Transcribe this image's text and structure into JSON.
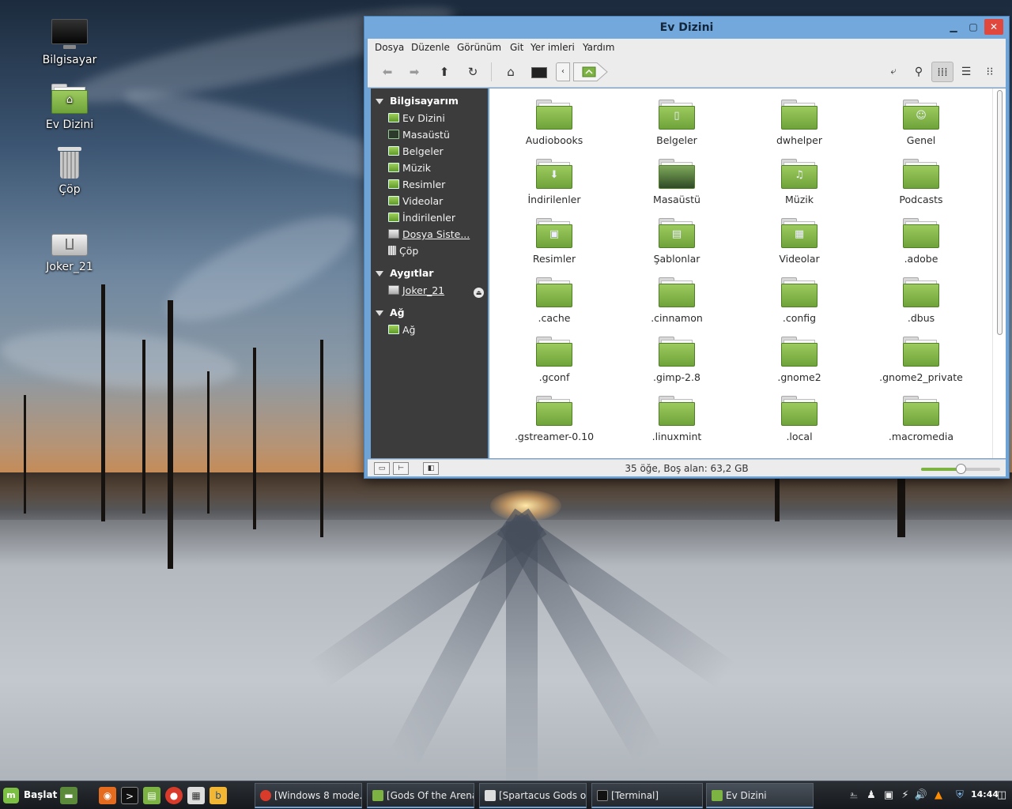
{
  "desktop": {
    "icons": [
      {
        "label": "Bilgisayar",
        "icon": "computer-icon"
      },
      {
        "label": "Ev Dizini",
        "icon": "home-folder-icon"
      },
      {
        "label": "Çöp",
        "icon": "trash-icon"
      },
      {
        "label": "Joker_21",
        "icon": "usb-drive-icon"
      }
    ]
  },
  "window": {
    "title": "Ev Dizini",
    "controls": {
      "minimize": "▁",
      "maximize": "▢",
      "close": "✕"
    },
    "menu": [
      "Dosya",
      "Düzenle",
      "Görünüm",
      "Git",
      "Yer imleri",
      "Yardım"
    ],
    "toolbar": {
      "buttons": [
        "back-icon",
        "forward-icon",
        "up-icon",
        "reload-icon",
        "home-icon",
        "computer-icon"
      ],
      "path_left": "‹",
      "views": [
        "icon-view-icon",
        "list-view-icon",
        "compact-view-icon"
      ]
    },
    "sidebar": {
      "sections": [
        {
          "title": "Bilgisayarım",
          "items": [
            "Ev Dizini",
            "Masaüstü",
            "Belgeler",
            "Müzik",
            "Resimler",
            "Videolar",
            "İndirilenler",
            "Dosya Siste...",
            "Çöp"
          ]
        },
        {
          "title": "Aygıtlar",
          "items": [
            "Joker_21"
          ]
        },
        {
          "title": "Ağ",
          "items": [
            "Ağ"
          ]
        }
      ]
    },
    "files": [
      "Audiobooks",
      "Belgeler",
      "dwhelper",
      "Genel",
      "İndirilenler",
      "Masaüstü",
      "Müzik",
      "Podcasts",
      "Resimler",
      "Şablonlar",
      "Videolar",
      ".adobe",
      ".cache",
      ".cinnamon",
      ".config",
      ".dbus",
      ".gconf",
      ".gimp-2.8",
      ".gnome2",
      ".gnome2_private",
      ".gstreamer-0.10",
      ".linuxmint",
      ".local",
      ".macromedia"
    ],
    "status": "35 öğe, Boş alan: 63,2 GB",
    "zoom_level": 0.5
  },
  "taskbar": {
    "start_label": "Başlat",
    "tasks": [
      "[Windows 8 mode...",
      "[Gods Of the Arena]",
      "[Spartacus Gods o...",
      "[Terminal]",
      "Ev Dizini"
    ],
    "clock": "14:44"
  },
  "colors": {
    "titlebar": "#72a8dc",
    "folder_green": "#7cb342",
    "close_red": "#e0483e",
    "sidebar_bg": "#3c3c3c"
  }
}
